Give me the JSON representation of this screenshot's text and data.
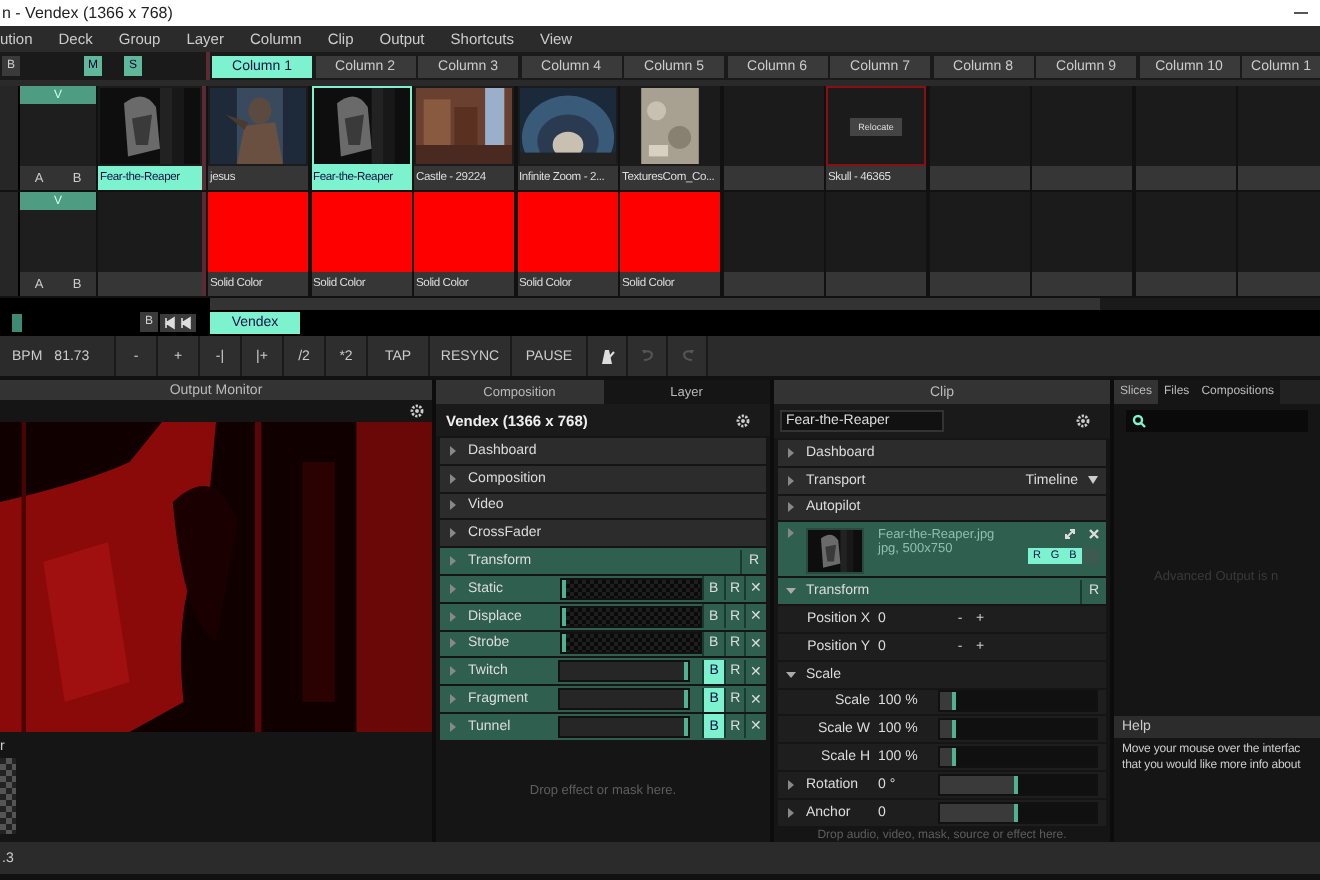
{
  "window": {
    "title": "n - Vendex (1366 x 768)"
  },
  "menu": [
    "ution",
    "Deck",
    "Group",
    "Layer",
    "Column",
    "Clip",
    "Output",
    "Shortcuts",
    "View"
  ],
  "header_buttons": [
    {
      "label": "B",
      "on": false
    },
    {
      "label": "M",
      "on": true
    },
    {
      "label": "S",
      "on": true
    }
  ],
  "columns": [
    {
      "label": "Column 1",
      "selected": true
    },
    {
      "label": "Column 2",
      "selected": false
    },
    {
      "label": "Column 3",
      "selected": false
    },
    {
      "label": "Column 4",
      "selected": false
    },
    {
      "label": "Column 5",
      "selected": false
    },
    {
      "label": "Column 6",
      "selected": false
    },
    {
      "label": "Column 7",
      "selected": false
    },
    {
      "label": "Column 8",
      "selected": false
    },
    {
      "label": "Column 9",
      "selected": false
    },
    {
      "label": "Column 10",
      "selected": false
    },
    {
      "label": "Column 1",
      "selected": false
    }
  ],
  "layers": [
    {
      "video": "V",
      "buttons": [
        "A",
        "B"
      ],
      "current": {
        "kind": "picture",
        "name": "Fear-the-Reaper"
      },
      "clips": [
        {
          "kind": "picture",
          "name": "jesus",
          "selected": false
        },
        {
          "kind": "picture",
          "name": "Fear-the-Reaper",
          "selected": true
        },
        {
          "kind": "picture",
          "name": "Castle - 29224",
          "selected": false
        },
        {
          "kind": "picture",
          "name": "Infinite Zoom - 2...",
          "selected": false
        },
        {
          "kind": "picture",
          "name": "TexturesCom_Co...",
          "selected": false
        },
        {
          "kind": "empty",
          "selected": false
        },
        {
          "kind": "missing",
          "name": "Skull - 46365",
          "action": "Relocate",
          "selected": false
        },
        {
          "kind": "empty",
          "selected": false
        },
        {
          "kind": "empty",
          "selected": false
        },
        {
          "kind": "empty",
          "selected": false
        },
        {
          "kind": "empty",
          "selected": false
        }
      ]
    },
    {
      "video": "V",
      "buttons": [
        "A",
        "B"
      ],
      "current": {
        "kind": "empty"
      },
      "clips": [
        {
          "kind": "solid",
          "name": "Solid Color",
          "color": "#ff0000",
          "selected": false
        },
        {
          "kind": "solid",
          "name": "Solid Color",
          "color": "#ff0000",
          "selected": false
        },
        {
          "kind": "solid",
          "name": "Solid Color",
          "color": "#ff0000",
          "selected": false
        },
        {
          "kind": "solid",
          "name": "Solid Color",
          "color": "#ff0000",
          "selected": false
        },
        {
          "kind": "solid",
          "name": "Solid Color",
          "color": "#ff0000",
          "selected": false
        },
        {
          "kind": "empty",
          "selected": false
        },
        {
          "kind": "empty",
          "selected": false
        },
        {
          "kind": "empty",
          "selected": false
        },
        {
          "kind": "empty",
          "selected": false
        },
        {
          "kind": "empty",
          "selected": false
        },
        {
          "kind": "empty",
          "selected": false
        }
      ]
    }
  ],
  "deck": {
    "button": "B",
    "tabs": [
      {
        "label": "Vendex",
        "selected": true
      }
    ]
  },
  "toolbar": {
    "bpm_label": "BPM",
    "bpm": "81.73",
    "buttons": [
      "-",
      "+",
      "-|",
      "|+",
      "/2",
      "*2",
      "TAP",
      "RESYNC",
      "PAUSE"
    ]
  },
  "output_monitor": {
    "title": "Output Monitor",
    "caption": "r"
  },
  "composition_panel": {
    "tabs": [
      {
        "label": "Composition",
        "selected": true
      },
      {
        "label": "Layer",
        "selected": false
      }
    ],
    "title": "Vendex (1366 x 768)",
    "rows": [
      {
        "kind": "section",
        "label": "Dashboard",
        "expanded": false
      },
      {
        "kind": "section",
        "label": "Composition",
        "expanded": false
      },
      {
        "kind": "section",
        "label": "Video",
        "expanded": false
      },
      {
        "kind": "section",
        "label": "CrossFader",
        "expanded": false
      },
      {
        "kind": "transform",
        "label": "Transform",
        "expanded": false,
        "reset": "R"
      },
      {
        "kind": "effect",
        "label": "Static",
        "expanded": false,
        "preview": true,
        "level": 0,
        "bypassed": false,
        "buttons": [
          "B",
          "R",
          "✕"
        ]
      },
      {
        "kind": "effect",
        "label": "Displace",
        "expanded": false,
        "preview": true,
        "level": 0,
        "bypassed": false,
        "buttons": [
          "B",
          "R",
          "✕"
        ]
      },
      {
        "kind": "effect",
        "label": "Strobe",
        "expanded": false,
        "preview": true,
        "level": 0,
        "bypassed": false,
        "buttons": [
          "B",
          "R",
          "✕"
        ]
      },
      {
        "kind": "effect",
        "label": "Twitch",
        "expanded": false,
        "preview": false,
        "level": 1,
        "bypassed": true,
        "buttons": [
          "B",
          "R",
          "✕"
        ]
      },
      {
        "kind": "effect",
        "label": "Fragment",
        "expanded": false,
        "preview": false,
        "level": 1,
        "bypassed": true,
        "buttons": [
          "B",
          "R",
          "✕"
        ]
      },
      {
        "kind": "effect",
        "label": "Tunnel",
        "expanded": false,
        "preview": false,
        "level": 1,
        "bypassed": true,
        "buttons": [
          "B",
          "R",
          "✕"
        ]
      }
    ],
    "drop_hint": "Drop effect or mask here."
  },
  "clip_panel": {
    "title": "Clip",
    "name": "Fear-the-Reaper",
    "rows": [
      {
        "kind": "section",
        "label": "Dashboard",
        "expanded": false
      },
      {
        "kind": "section",
        "label": "Transport",
        "expanded": false,
        "dropdown": "Timeline"
      },
      {
        "kind": "section",
        "label": "Autopilot",
        "expanded": false
      },
      {
        "kind": "file",
        "expanded": false,
        "filename": "Fear-the-Reaper.jpg",
        "info": "jpg, 500x750",
        "channels": [
          {
            "label": "R",
            "on": true
          },
          {
            "label": "G",
            "on": true
          },
          {
            "label": "B",
            "on": true
          },
          {
            "on": false
          }
        ]
      },
      {
        "kind": "transform",
        "label": "Transform",
        "expanded": true,
        "reset": "R"
      },
      {
        "kind": "param",
        "label": "Position X",
        "value": "0",
        "buttons": [
          "-",
          "+"
        ]
      },
      {
        "kind": "param",
        "label": "Position Y",
        "value": "0",
        "buttons": [
          "-",
          "+"
        ]
      },
      {
        "kind": "group",
        "label": "Scale",
        "expanded": true
      },
      {
        "kind": "slider",
        "label": "Scale",
        "value": "100 %",
        "level": 0.1
      },
      {
        "kind": "slider",
        "label": "Scale W",
        "value": "100 %",
        "level": 0.1
      },
      {
        "kind": "slider",
        "label": "Scale H",
        "value": "100 %",
        "level": 0.1
      },
      {
        "kind": "slider",
        "label": "Rotation",
        "value": "0 °",
        "level": 0.5,
        "expanded": false
      },
      {
        "kind": "slider",
        "label": "Anchor",
        "value": "0",
        "level": 0.5,
        "expanded": false
      }
    ],
    "drop_hint": "Drop audio, video, mask, source or effect here."
  },
  "browser": {
    "tabs": [
      {
        "label": "Slices",
        "selected": true
      },
      {
        "label": "Files",
        "selected": false
      },
      {
        "label": "Compositions",
        "selected": false
      }
    ],
    "notice": "Advanced Output is n",
    "help_title": "Help",
    "help_lines": [
      "Move your mouse over the interfac",
      "that you would like more info about"
    ]
  },
  "status_bar": {
    "text": ".3"
  }
}
